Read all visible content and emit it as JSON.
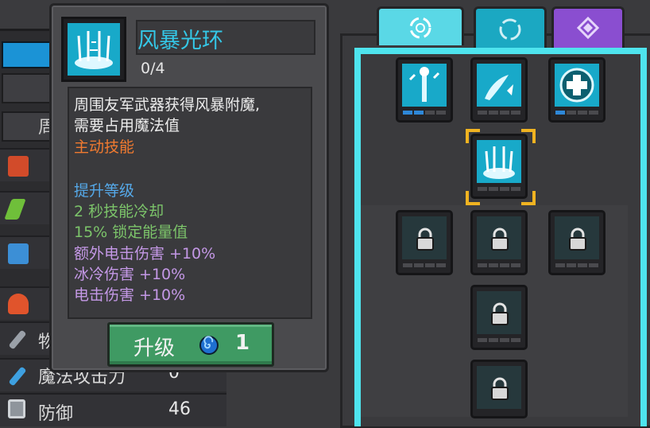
{
  "stats_panel": {
    "partial_label_a": "周",
    "rows": [
      {
        "label": "物",
        "value": "",
        "icon": "sword-icon"
      },
      {
        "label": "魔法攻击力",
        "value": "0",
        "icon": "wand-icon"
      },
      {
        "label": "防御",
        "value": "46",
        "icon": "shield-icon"
      }
    ]
  },
  "tooltip": {
    "skill_name": "风暴光环",
    "level": "0/4",
    "description_lines": [
      "周围友军武器获得风暴附魔,",
      "需要占用魔法值"
    ],
    "skill_type": "主动技能",
    "upgrade_header": "提升等级",
    "upgrade_effects": [
      "2 秒技能冷却",
      "15% 锁定能量值"
    ],
    "bonus_effects": [
      "额外电击伤害 +10%",
      "冰冷伤害 +10%",
      "电击伤害 +10%"
    ],
    "upgrade_button": {
      "label": "升级",
      "cost_icon": "swirl-gem-icon",
      "cost": "1"
    }
  },
  "skill_tree": {
    "tabs": [
      {
        "icon": "vortex-icon",
        "active": true
      },
      {
        "icon": "ring-icon",
        "active": false
      },
      {
        "icon": "crest-icon",
        "active": false
      }
    ],
    "nodes": [
      {
        "id": "staff-lightning",
        "icon": "staff-lightning-icon",
        "locked": false,
        "progress": [
          1,
          1,
          0,
          0
        ]
      },
      {
        "id": "wind-slash",
        "icon": "wind-slash-icon",
        "locked": false,
        "progress": [
          0,
          0,
          0,
          0
        ]
      },
      {
        "id": "heal-cross",
        "icon": "heal-cross-icon",
        "locked": false,
        "progress": [
          1,
          0,
          0,
          0
        ]
      },
      {
        "id": "storm-aura",
        "icon": "storm-aura-icon",
        "locked": false,
        "selected": true,
        "progress": [
          0,
          0,
          0,
          0
        ]
      },
      {
        "id": "locked-1",
        "icon": "lock-icon",
        "locked": true,
        "progress": [
          0,
          0,
          0,
          0
        ]
      },
      {
        "id": "locked-2",
        "icon": "lock-icon",
        "locked": true,
        "progress": [
          0,
          0,
          0,
          0
        ]
      },
      {
        "id": "locked-3",
        "icon": "lock-icon",
        "locked": true,
        "progress": [
          0,
          0,
          0,
          0
        ]
      },
      {
        "id": "locked-4",
        "icon": "lock-icon",
        "locked": true,
        "progress": [
          0,
          0,
          0,
          0
        ]
      },
      {
        "id": "locked-5",
        "icon": "lock-icon",
        "locked": true,
        "progress": [
          0,
          0,
          0,
          0
        ]
      }
    ]
  },
  "colors": {
    "accent_cyan": "#4ee4ee",
    "skill_name": "#34c8e8",
    "active_text": "#f07a30",
    "upgrade_header": "#55a8e8",
    "upgrade_effect": "#7cc46a",
    "bonus_effect": "#c498e6",
    "upgrade_button": "#3f9a63",
    "selected_frame": "#f0b321"
  }
}
